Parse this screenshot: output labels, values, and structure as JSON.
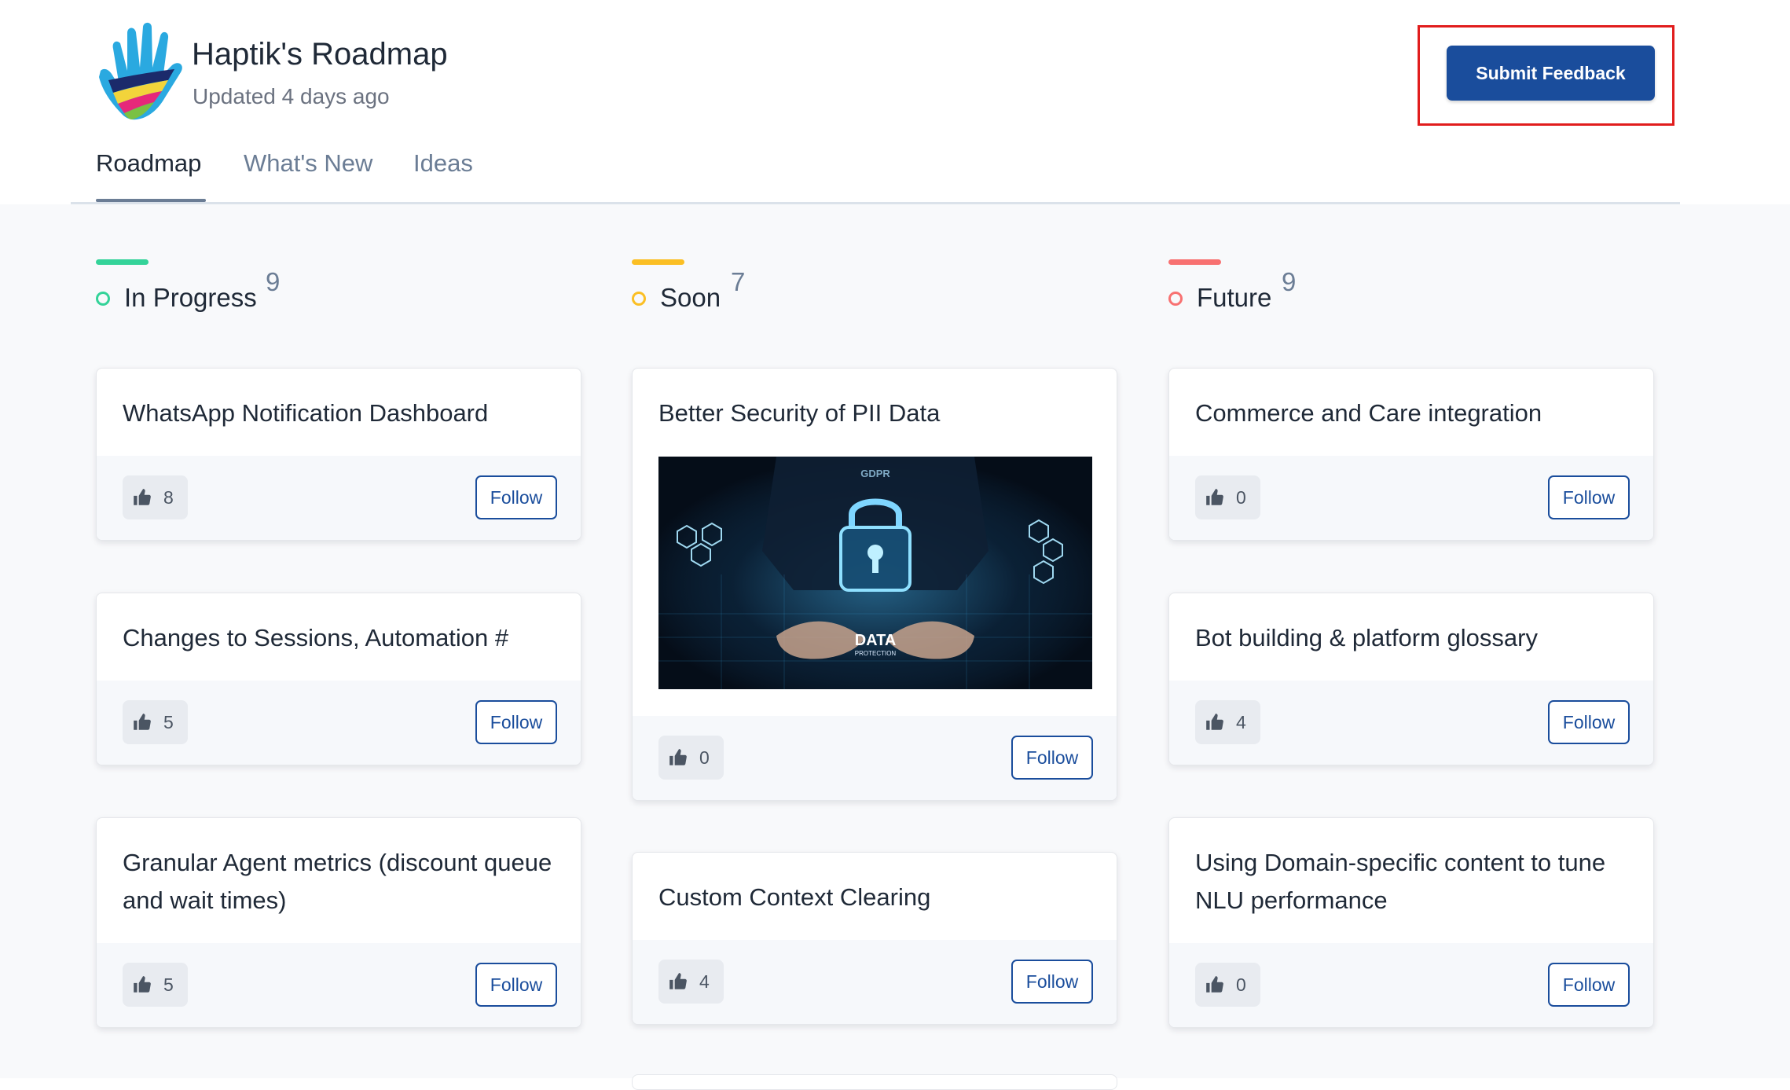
{
  "header": {
    "title": "Haptik's Roadmap",
    "subtitle": "Updated 4 days ago",
    "submit_label": "Submit Feedback"
  },
  "tabs": [
    {
      "label": "Roadmap",
      "active": true
    },
    {
      "label": "What's New",
      "active": false
    },
    {
      "label": "Ideas",
      "active": false
    }
  ],
  "colors": {
    "accent": "#1a4d9c",
    "in_progress": "#34d399",
    "soon": "#fbbf24",
    "future": "#f87171",
    "highlight": "#e11d1d"
  },
  "columns": [
    {
      "name": "In Progress",
      "count": "9",
      "cards": [
        {
          "title": "WhatsApp Notification Dashboard",
          "votes": "8",
          "follow": "Follow"
        },
        {
          "title": "Changes to Sessions, Automation #",
          "votes": "5",
          "follow": "Follow"
        },
        {
          "title": "Granular Agent metrics (discount queue and wait times)",
          "votes": "5",
          "follow": "Follow"
        }
      ]
    },
    {
      "name": "Soon",
      "count": "7",
      "cards": [
        {
          "title": "Better Security of PII Data",
          "votes": "0",
          "follow": "Follow",
          "image": {
            "heading": "GDPR",
            "label": "DATA",
            "sublabel": "PROTECTION"
          }
        },
        {
          "title": "Custom Context Clearing",
          "votes": "4",
          "follow": "Follow"
        }
      ]
    },
    {
      "name": "Future",
      "count": "9",
      "cards": [
        {
          "title": "Commerce and Care integration",
          "votes": "0",
          "follow": "Follow"
        },
        {
          "title": "Bot building & platform glossary",
          "votes": "4",
          "follow": "Follow"
        },
        {
          "title": "Using Domain-specific content to tune NLU performance",
          "votes": "0",
          "follow": "Follow"
        }
      ]
    }
  ]
}
